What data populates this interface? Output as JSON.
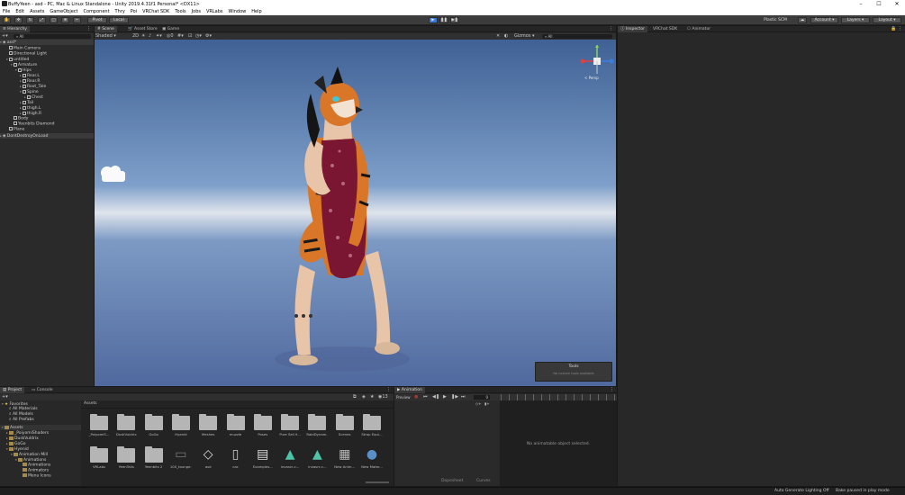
{
  "window": {
    "title": "BuffyYeen - asd - PC, Mac & Linux Standalone - Unity 2019.4.31f1 Personal* <DX11>",
    "min": "–",
    "max": "☐",
    "close": "✕"
  },
  "menu": [
    "File",
    "Edit",
    "Assets",
    "GameObject",
    "Component",
    "Thry",
    "Poi",
    "VRChat SDK",
    "Tools",
    "Jobs",
    "VRLabs",
    "Window",
    "Help"
  ],
  "toolbar": {
    "pivot": "Pivot",
    "local": "Local",
    "plastic": "Plastic SCM",
    "account": "Account",
    "layers": "Layers",
    "layout": "Layout"
  },
  "hierarchy": {
    "tab": "Hierarchy",
    "search": "All",
    "scene": "asd*",
    "items": [
      {
        "d": 1,
        "t": "Main Camera"
      },
      {
        "d": 1,
        "t": "Directional Light"
      },
      {
        "d": 1,
        "t": "untitled",
        "a": "▾"
      },
      {
        "d": 2,
        "t": "Armature",
        "a": "▾"
      },
      {
        "d": 3,
        "t": "Hips",
        "a": "▾"
      },
      {
        "d": 4,
        "t": "Rear.L",
        "a": "▸"
      },
      {
        "d": 4,
        "t": "Rear.R",
        "a": "▸"
      },
      {
        "d": 4,
        "t": "Root_Tale",
        "a": "▸"
      },
      {
        "d": 4,
        "t": "Spine",
        "a": "▾"
      },
      {
        "d": 5,
        "t": "Chest",
        "a": "▸"
      },
      {
        "d": 4,
        "t": "Tail",
        "a": "▸"
      },
      {
        "d": 4,
        "t": "thigh.L",
        "a": "▸"
      },
      {
        "d": 4,
        "t": "thigh.R",
        "a": "▸"
      },
      {
        "d": 2,
        "t": "Body"
      },
      {
        "d": 2,
        "t": "Yeenbits Diamond"
      },
      {
        "d": 1,
        "t": "Plane"
      }
    ],
    "ddol": "DontDestroyOnLoad"
  },
  "scene_tabs": [
    "Scene",
    "Asset Store",
    "Game"
  ],
  "scene_bar": {
    "shaded": "Shaded",
    "twod": "2D",
    "gizmos": "Gizmos",
    "search": "All"
  },
  "gizmo": {
    "persp": "< Persp"
  },
  "tools_overlay": {
    "title": "Tools",
    "body": "No custom tools available"
  },
  "right_tabs": [
    "Inspector",
    "VRChat SDK",
    "Animator"
  ],
  "project": {
    "tabs": [
      "Project",
      "Console"
    ],
    "breadcrumb": "Assets",
    "count": "13",
    "favorites": {
      "label": "Favorites",
      "items": [
        "All Materials",
        "All Models",
        "All Prefabs"
      ]
    },
    "tree": [
      {
        "d": 0,
        "t": "Assets",
        "a": "▾"
      },
      {
        "d": 1,
        "t": "_PoiyomiShaders",
        "a": "▸"
      },
      {
        "d": 1,
        "t": "DuskVuldrix",
        "a": "▸"
      },
      {
        "d": 1,
        "t": "GoGo",
        "a": "▸"
      },
      {
        "d": 1,
        "t": "Hyenid",
        "a": "▾"
      },
      {
        "d": 2,
        "t": "Animation Mill",
        "a": "▾"
      },
      {
        "d": 3,
        "t": "Animations",
        "a": "▾"
      },
      {
        "d": 4,
        "t": "Animations",
        "a": ""
      },
      {
        "d": 4,
        "t": "Animators",
        "a": ""
      },
      {
        "d": 4,
        "t": "Menu Icons",
        "a": ""
      }
    ],
    "assets_row1": [
      "_PoiyomiS...",
      "DuskVuldrix",
      "GoGo",
      "Hyenid",
      "Meshes",
      "muzzle",
      "Poses",
      "Pure Set H...",
      "RabiDynam...",
      "Scenes",
      "Strap Equi..."
    ],
    "assets_row2": [
      "VRLabs",
      "YeenTails",
      "Yeenbits 2",
      "100_tounge...",
      "asd",
      "cac",
      "Examples...",
      "invasrc.c...",
      "invasrc.c...",
      "New Anim...",
      "New Mater..."
    ]
  },
  "animation": {
    "tab": "Animation",
    "preview": "Preview",
    "empty": "No animatable object selected.",
    "dopesheet": "Dopesheet",
    "curves": "Curves",
    "frame": "0"
  },
  "status": {
    "lighting": "Auto Generate Lighting Off",
    "bake": "Bake paused in play mode"
  },
  "colors": {
    "accent": "#3a79d8",
    "dark": "#191919"
  }
}
